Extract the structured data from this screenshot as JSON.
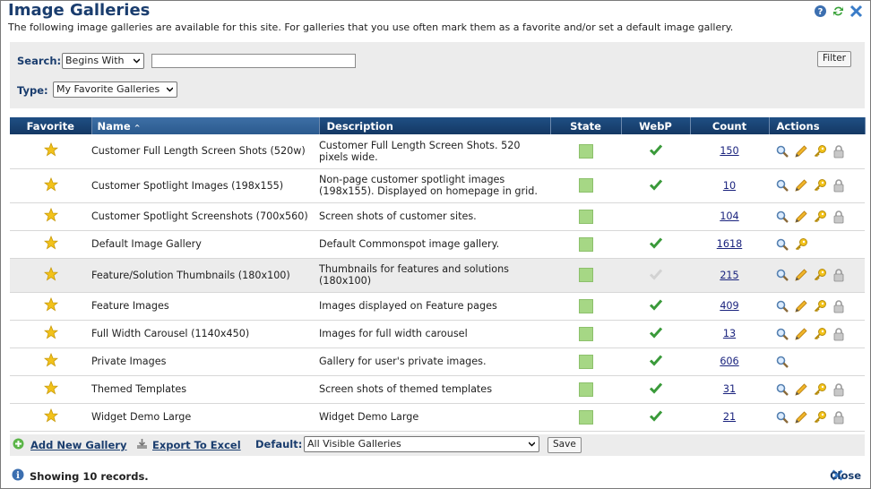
{
  "header": {
    "title": "Image Galleries",
    "subtitle": "The following image galleries are available for this site. For galleries that you use often mark them as a favorite and/or set a default image gallery."
  },
  "filters": {
    "search_label": "Search:",
    "search_mode": "Begins With",
    "search_value": "",
    "filter_button": "Filter",
    "type_label": "Type:",
    "type_value": "My Favorite Galleries"
  },
  "columns": {
    "favorite": "Favorite",
    "name": "Name",
    "description": "Description",
    "state": "State",
    "webp": "WebP",
    "count": "Count",
    "actions": "Actions"
  },
  "rows": [
    {
      "name": "Customer Full Length Screen Shots (520w)",
      "desc1": "Customer Full Length Screen Shots. 520",
      "desc2": "pixels wide.",
      "webp": true,
      "count": "150",
      "actions": [
        "view",
        "edit",
        "key",
        "lock"
      ]
    },
    {
      "name": "Customer Spotlight Images (198x155)",
      "desc1": "Non-page customer spotlight images",
      "desc2": "(198x155). Displayed on homepage in grid.",
      "webp": true,
      "count": "10",
      "actions": [
        "view",
        "edit",
        "key",
        "lock"
      ]
    },
    {
      "name": "Customer Spotlight Screenshots (700x560)",
      "desc1": "Screen shots of customer sites.",
      "desc2": "",
      "webp": false,
      "count": "104",
      "actions": [
        "view",
        "edit",
        "key",
        "lock"
      ]
    },
    {
      "name": "Default Image Gallery",
      "desc1": "Default Commonspot image gallery.",
      "desc2": "",
      "webp": true,
      "count": "1618",
      "actions": [
        "view",
        "key"
      ]
    },
    {
      "name": "Feature/Solution Thumbnails (180x100)",
      "desc1": "Thumbnails for features and solutions",
      "desc2": "(180x100)",
      "webp": "dim",
      "count": "215",
      "actions": [
        "view",
        "edit",
        "key",
        "lock"
      ]
    },
    {
      "name": "Feature Images",
      "desc1": "Images displayed on Feature pages",
      "desc2": "",
      "webp": true,
      "count": "409",
      "actions": [
        "view",
        "edit",
        "key",
        "lock"
      ]
    },
    {
      "name": "Full Width Carousel (1140x450)",
      "desc1": "Images for full width carousel",
      "desc2": "",
      "webp": true,
      "count": "13",
      "actions": [
        "view",
        "edit",
        "key",
        "lock"
      ]
    },
    {
      "name": "Private Images",
      "desc1": "Gallery for user's private images.",
      "desc2": "",
      "webp": true,
      "count": "606",
      "actions": [
        "view"
      ]
    },
    {
      "name": "Themed Templates",
      "desc1": "Screen shots of themed templates",
      "desc2": "",
      "webp": true,
      "count": "31",
      "actions": [
        "view",
        "edit",
        "key",
        "lock"
      ]
    },
    {
      "name": "Widget Demo Large",
      "desc1": "Widget Demo Large",
      "desc2": "",
      "webp": true,
      "count": "21",
      "actions": [
        "view",
        "edit",
        "key",
        "lock"
      ]
    }
  ],
  "footer": {
    "add_new": "Add New Gallery",
    "export": "Export To Excel",
    "default_label": "Default:",
    "default_value": "All Visible Galleries",
    "save": "Save",
    "status": "Showing 10 records.",
    "close": "Close"
  },
  "colors": {
    "header_blue": "#1a3d6e",
    "state_green": "#a6d785",
    "check_green": "#3a9a3a",
    "star_gold": "#f2c21a"
  }
}
